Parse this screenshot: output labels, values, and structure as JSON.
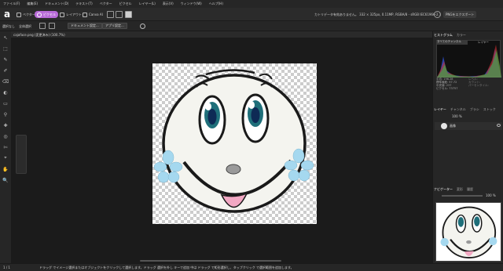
{
  "menu": [
    "ファイル(F)",
    "編集(E)",
    "ドキュメント(D)",
    "テキスト(T)",
    "ベクター",
    "ピクセル",
    "レイヤー(L)",
    "表示(V)",
    "ウィンドウ(W)",
    "ヘルプ(H)"
  ],
  "app_logo": "a",
  "personas": [
    {
      "label": "ベクター",
      "active": false
    },
    {
      "label": "ピクセル",
      "active": true
    },
    {
      "label": "レイアウト",
      "active": false
    },
    {
      "label": "Canva AI",
      "active": false
    }
  ],
  "toolbar": {
    "docinfo": "カトリデータ有効ありません。    332 × 325px, 0.11MP, RGBA/8 - sRGB IEC61966-2.1",
    "color_format": "RGBA/8",
    "share_label": "PNGをエクスポート",
    "accent_color": "#b86bd8"
  },
  "context": {
    "selection": "選択なし",
    "all_layers": "全体選択",
    "doc_settings": "ドキュメント設定...",
    "prefs": "アプリ設定..."
  },
  "document": {
    "tab_title": "cajoface.png (変更済み) (100.7%)"
  },
  "right_panel": {
    "tabs_top": [
      "ヒストグラム",
      "カラー"
    ],
    "histogram_channel": "すべてのチャンネル",
    "histogram_tab2": "レイヤー",
    "stats_left": [
      "平均: 196.28",
      "標準偏差: 97.72",
      "中央値: 237",
      "ピクセル: 73757"
    ],
    "stats_right": [
      "レベル:",
      "カウント:",
      "パーセンタイル:"
    ],
    "tabs_mid": [
      "レイヤー",
      "チャンネル",
      "ブラシ",
      "ストック"
    ],
    "opacity": "100 %",
    "layer_name": "画像",
    "tabs_bottom": [
      "ナビゲーター",
      "変形",
      "履歴"
    ],
    "zoom": "100 %"
  },
  "status": {
    "page": "1 / 1",
    "hint": "ドラッグ でイメージ選択またはオブジェクトをクリックして選択します。ドラッグ 選択を外し キーで追加 中は ドラッグ で矩形選択し、タップクリック で選択範囲を追加します。"
  },
  "face_colors": {
    "iris": "#1f6f7a",
    "pupil": "#0e2a55",
    "cheek": "#a5d8ef",
    "tongue": "#f2a8c3",
    "nose": "#9a9a9a",
    "skin": "#f4f4ef"
  }
}
